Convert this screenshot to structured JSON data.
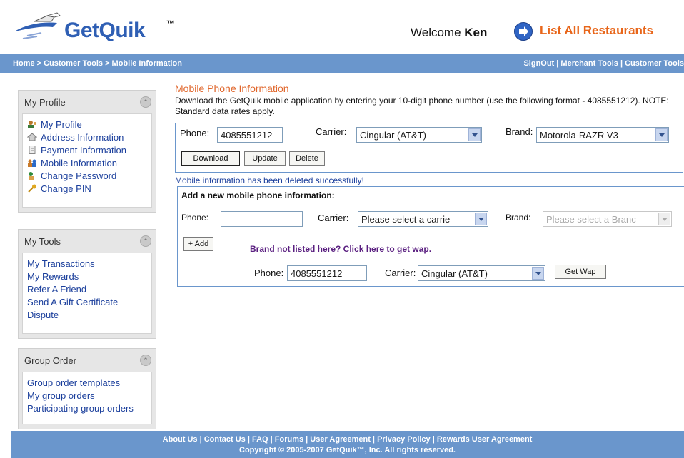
{
  "header": {
    "logo_text": "GetQuik",
    "logo_tm": "™",
    "welcome_prefix": "Welcome",
    "user_name": "Ken",
    "list_link": "List All Restaurants"
  },
  "navbar": {
    "breadcrumb": "Home > Customer Tools > Mobile Information",
    "links": "SignOut | Merchant Tools | Customer Tools"
  },
  "sidebar": {
    "profile": {
      "title": "My Profile",
      "items": [
        "My Profile",
        "Address Information",
        "Payment Information",
        "Mobile Information",
        "Change Password",
        "Change PIN"
      ]
    },
    "tools": {
      "title": "My Tools",
      "items": [
        "My Transactions",
        "My Rewards",
        "Refer A Friend",
        "Send A Gift Certificate",
        "Dispute"
      ]
    },
    "group": {
      "title": "Group Order",
      "items": [
        "Group order templates",
        "My group orders",
        "Participating group orders"
      ]
    }
  },
  "main": {
    "title": "Mobile Phone Information",
    "intro": "Download the GetQuik mobile application by entering your 10-digit phone number (use the following format - 4085551212). NOTE: Standard data rates apply.",
    "existing": {
      "phone_label": "Phone:",
      "phone_value": "4085551212",
      "carrier_label": "Carrier:",
      "carrier_value": "Cingular (AT&T)",
      "brand_label": "Brand:",
      "brand_value": "Motorola-RAZR V3",
      "buttons": {
        "download": "Download",
        "update": "Update",
        "delete": "Delete"
      }
    },
    "success_message": "Mobile information has been deleted successfully!",
    "new": {
      "heading": "Add a new mobile phone information:",
      "phone_label": "Phone:",
      "phone_value": "",
      "carrier_label": "Carrier:",
      "carrier_value": "Please select a carrie",
      "brand_label": "Brand:",
      "brand_value": "Please select a Branc",
      "add_button": "+ Add",
      "getwap_link": "Brand not listed here? Click here to get wap.",
      "wap_phone_label": "Phone:",
      "wap_phone_value": "4085551212",
      "wap_carrier_label": "Carrier:",
      "wap_carrier_value": "Cingular (AT&T)",
      "getwap_button": "Get Wap"
    }
  },
  "footer": {
    "links": "About Us | Contact Us | FAQ | Forums | User Agreement | Privacy Policy | Rewards User Agreement",
    "copyright": "Copyright © 2005-2007 GetQuik™, Inc. All rights reserved."
  },
  "colors": {
    "nav_blue": "#6a96cc",
    "title_orange": "#e0662b",
    "link_blue": "#1b3f9c"
  }
}
